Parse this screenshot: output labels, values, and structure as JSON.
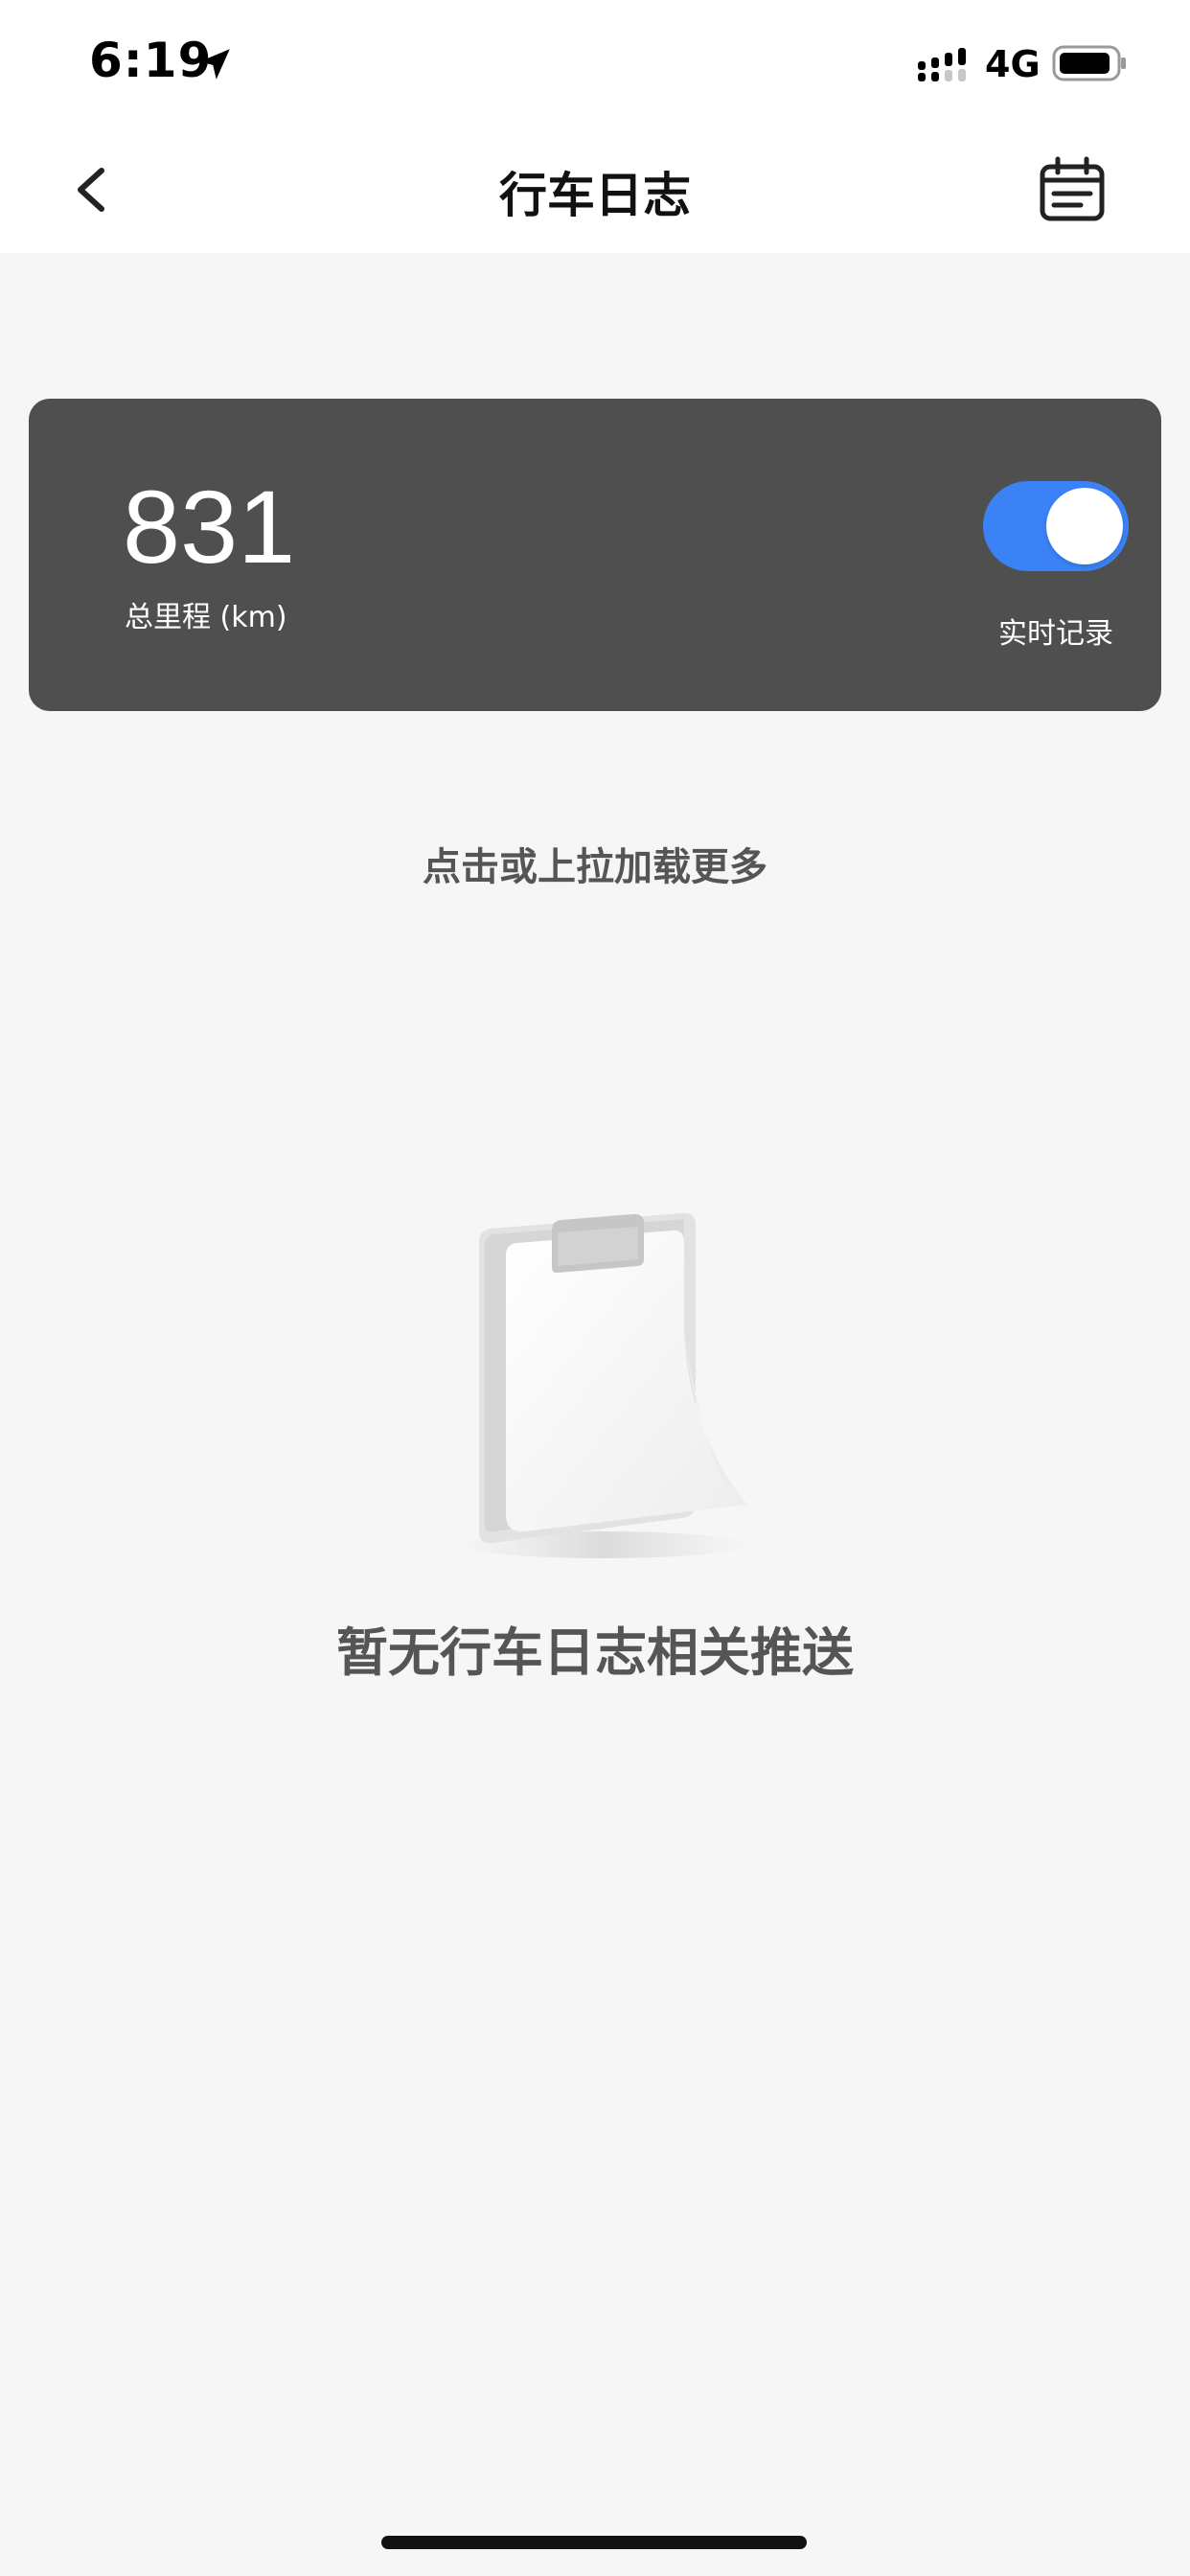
{
  "status_bar": {
    "time": "6:19",
    "network": "4G",
    "icons": [
      "location-arrow-icon",
      "signal-icon",
      "battery-icon"
    ]
  },
  "nav": {
    "title": "行车日志",
    "back_icon": "chevron-left-icon",
    "calendar_icon": "calendar-icon"
  },
  "mileage_card": {
    "value": "831",
    "label": "总里程 (km)",
    "toggle_label": "实时记录",
    "toggle_on": true,
    "background_color": "#4f4f4f",
    "toggle_color": "#3b82f6"
  },
  "load_more": "点击或上拉加载更多",
  "empty_state": {
    "icon": "notepad-illustration",
    "message": "暂无行车日志相关推送"
  }
}
